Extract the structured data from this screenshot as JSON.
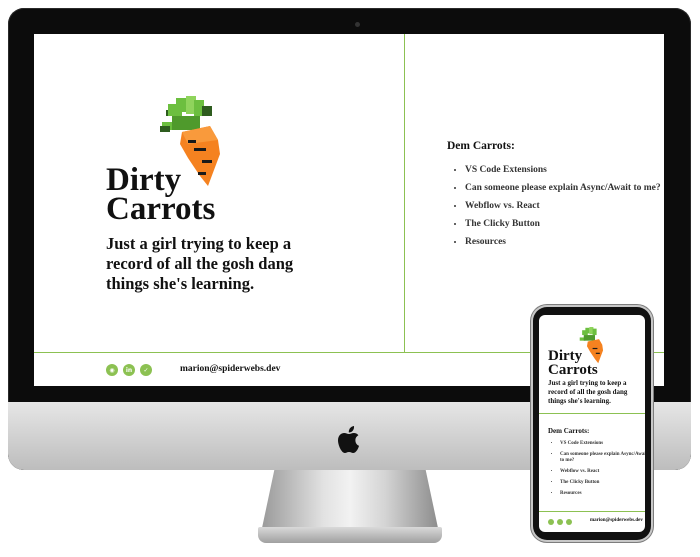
{
  "site": {
    "title_line1": "Dirty",
    "title_line2": "Carrots",
    "tagline": "Just a girl trying to keep a record of all the gosh dang things she's learning.",
    "list_heading": "Dem Carrots:",
    "topics": [
      "VS Code Extensions",
      "Can someone please explain Async/Await to me?",
      "Webflow vs. React",
      "The Clicky Button",
      "Resources"
    ],
    "social_icons": [
      "github-icon",
      "linkedin-icon",
      "twitter-icon"
    ],
    "email": "marion@spiderwebs.dev"
  },
  "colors": {
    "accent": "#8cc152",
    "carrot_orange": "#f58220",
    "carrot_leaf": "#6cbf3f",
    "text": "#111111"
  },
  "icons": [
    "carrot-icon",
    "apple-logo-icon"
  ]
}
